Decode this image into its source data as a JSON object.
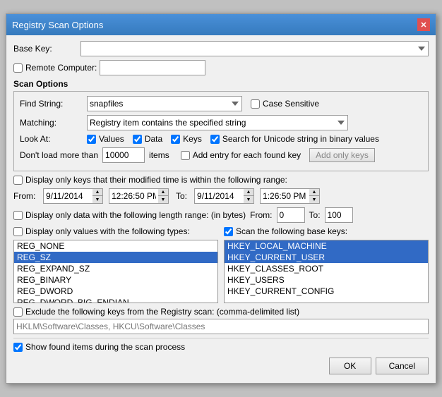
{
  "dialog": {
    "title": "Registry Scan Options",
    "close_button": "✕"
  },
  "base_key": {
    "label": "Base Key:",
    "value": "",
    "placeholder": ""
  },
  "remote_computer": {
    "label": "Remote Computer:",
    "checked": false,
    "value": ""
  },
  "scan_options": {
    "section_label": "Scan Options",
    "find_string": {
      "label": "Find String:",
      "value": "snapfiles",
      "options": [
        "snapfiles"
      ]
    },
    "case_sensitive": {
      "label": "Case Sensitive",
      "checked": false
    },
    "matching": {
      "label": "Matching:",
      "value": "Registry item contains the specified string",
      "options": [
        "Registry item contains the specified string"
      ]
    },
    "look_at": {
      "label": "Look At:",
      "values_label": "Values",
      "values_checked": true,
      "data_label": "Data",
      "data_checked": true,
      "keys_label": "Keys",
      "keys_checked": true,
      "unicode_label": "Search for Unicode string in binary values",
      "unicode_checked": true
    },
    "dont_load": {
      "label": "Don't load more than",
      "value": "10000",
      "items_label": "items",
      "add_entry_label": "Add entry for each found key",
      "add_entry_checked": false,
      "add_only_keys_label": "Add only keys",
      "add_only_keys_disabled": true
    }
  },
  "display_modified": {
    "label": "Display only keys that their modified time is within the following range:",
    "checked": false,
    "from_label": "From:",
    "from_date": "9/11/2014",
    "from_time": "12:26:50 PM",
    "to_label": "To:",
    "to_date": "9/11/2014",
    "to_time": "1:26:50 PM"
  },
  "display_length": {
    "label": "Display only data with the following length range: (in bytes)",
    "checked": false,
    "from_label": "From:",
    "from_value": "0",
    "to_label": "To:",
    "to_value": "100"
  },
  "two_panels": {
    "left": {
      "label": "Display only values with the following types:",
      "checked": false,
      "items": [
        {
          "text": "REG_NONE",
          "selected": false
        },
        {
          "text": "REG_SZ",
          "selected": true
        },
        {
          "text": "REG_EXPAND_SZ",
          "selected": false
        },
        {
          "text": "REG_BINARY",
          "selected": false
        },
        {
          "text": "REG_DWORD",
          "selected": false
        },
        {
          "text": "REG_DWORD_BIG_ENDIAN",
          "selected": false
        }
      ]
    },
    "right": {
      "label": "Scan the following base keys:",
      "checked": true,
      "items": [
        {
          "text": "HKEY_LOCAL_MACHINE",
          "selected": true
        },
        {
          "text": "HKEY_CURRENT_USER",
          "selected": true
        },
        {
          "text": "HKEY_CLASSES_ROOT",
          "selected": false
        },
        {
          "text": "HKEY_USERS",
          "selected": false
        },
        {
          "text": "HKEY_CURRENT_CONFIG",
          "selected": false
        }
      ]
    }
  },
  "exclude": {
    "label": "Exclude the following keys from the Registry scan: (comma-delimited list)",
    "checked": false,
    "placeholder": "HKLM\\Software\\Classes, HKCU\\Software\\Classes"
  },
  "show_found": {
    "label": "Show found items during the scan process",
    "checked": true
  },
  "buttons": {
    "ok_label": "OK",
    "cancel_label": "Cancel"
  }
}
